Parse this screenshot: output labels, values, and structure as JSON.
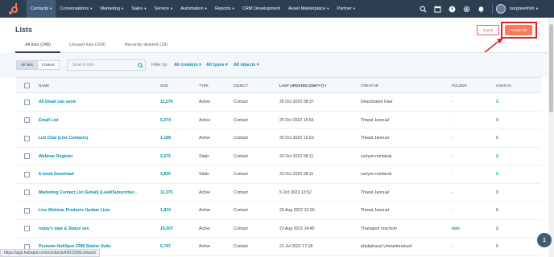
{
  "nav": {
    "items": [
      {
        "label": "Contacts",
        "active": true
      },
      {
        "label": "Conversations",
        "active": false
      },
      {
        "label": "Marketing",
        "active": false
      },
      {
        "label": "Sales",
        "active": false
      },
      {
        "label": "Service",
        "active": false
      },
      {
        "label": "Automation",
        "active": false
      },
      {
        "label": "Reports",
        "active": false
      },
      {
        "label": "CRM Development",
        "active": false,
        "no_caret": true
      },
      {
        "label": "Asset Marketplace",
        "active": false
      },
      {
        "label": "Partner",
        "active": false
      }
    ],
    "icons": [
      "search-icon",
      "marketplace-icon",
      "help-icon",
      "settings-icon",
      "notifications-icon"
    ],
    "account_name": "ourgreenfish"
  },
  "header": {
    "title": "Lists",
    "import_label": "Import",
    "create_label": "Create list"
  },
  "tabs": [
    {
      "label": "All lists (248)",
      "active": true
    },
    {
      "label": "Unused lists (209)",
      "active": false
    },
    {
      "label": "Recently deleted (18)",
      "active": false
    }
  ],
  "toolbar": {
    "view_all": "All lists",
    "view_folders": "Folders",
    "search_placeholder": "Search lists",
    "filter_label": "Filter by:",
    "filter_creators": "All creators",
    "filter_types": "All types",
    "filter_objects": "All objects"
  },
  "table": {
    "columns": [
      "NAME",
      "SIZE",
      "TYPE",
      "OBJECT",
      "LAST UPDATED (GMT+7)",
      "CREATOR",
      "FOLDER",
      "USED IN"
    ],
    "rows": [
      {
        "name": "All Email can send",
        "size": "11,274",
        "type": "Active",
        "object": "Contact",
        "updated": "26 Oct 2022 08:37",
        "creator": "Deactivated User",
        "folder": "-",
        "used": "3"
      },
      {
        "name": "Email List",
        "size": "5,274",
        "type": "Active",
        "object": "Contact",
        "updated": "25 Oct 2022 16:56",
        "creator": "Thiwat Jannual",
        "folder": "-",
        "used": "0"
      },
      {
        "name": "List Chat (Line Contacts)",
        "size": "1,168",
        "type": "Active",
        "object": "Contact",
        "updated": "25 Oct 2022 16:53",
        "creator": "Thiwat Jannual",
        "folder": "-",
        "used": "0"
      },
      {
        "name": "Webinar Register",
        "size": "2,075",
        "type": "Static",
        "object": "Contact",
        "updated": "20 Oct 2022 08:11",
        "creator": "suriyon nontarak",
        "folder": "-",
        "used": "2"
      },
      {
        "name": "E-book Download",
        "size": "4,830",
        "type": "Static",
        "object": "Contact",
        "updated": "20 Oct 2022 08:11",
        "creator": "suriyon nontarak",
        "folder": "-",
        "used": "2"
      },
      {
        "name": "Marketing Contact List (Email) (Lead/Subscriber...",
        "size": "11,375",
        "type": "Active",
        "object": "Contact",
        "updated": "5 Oct 2022 13:52",
        "creator": "Thiwat Jannual",
        "folder": "-",
        "used": "0"
      },
      {
        "name": "Live Webinar Products Update Lists",
        "size": "1,810",
        "type": "Active",
        "object": "Contact",
        "updated": "25 Aug 2022 12:20",
        "creator": "Thiwat Jannual",
        "folder": "-",
        "used": "0"
      },
      {
        "name": "today's date & Status yes",
        "size": "15,007",
        "type": "Active",
        "object": "Contact",
        "updated": "23 Aug 2022 14:45",
        "creator": "Thanapon orachorn",
        "folder": "toto",
        "used": "2"
      },
      {
        "name": "Promote HubSpot CRM Starter Suite",
        "size": "5,747",
        "type": "Active",
        "object": "Contact",
        "updated": "21 Jul 2022 17:18",
        "creator": "phakphasut Umnartnuntasit",
        "folder": "-",
        "used": "0"
      }
    ]
  },
  "status_url": "https://app.hubspot.com/contacts/4351158/contacts",
  "chat_badge": "1",
  "colors": {
    "nav_bg": "#2d3e50",
    "accent": "#ff7a59",
    "link": "#0091ae",
    "highlight": "#e0202a"
  }
}
